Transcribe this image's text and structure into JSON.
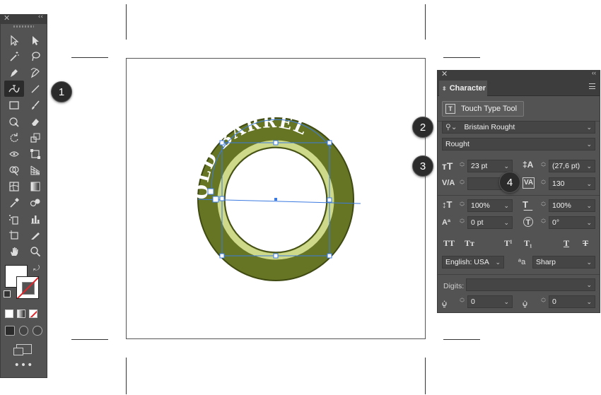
{
  "badges": [
    "1",
    "2",
    "3",
    "4"
  ],
  "artwork": {
    "curved_text": "OLD BARREL",
    "ring_color": "#667523",
    "ring_highlight": "#cfd98a",
    "text_color": "#ffffff",
    "selection_color": "#3b7ae0"
  },
  "character_panel": {
    "tab_label": "Character",
    "touch_type_label": "Touch Type Tool",
    "font_family": "Bristain Rought",
    "font_style": "Rought",
    "font_size": "23 pt",
    "leading": "(27,6 pt)",
    "kerning": "",
    "tracking": "130",
    "vertical_scale": "100%",
    "horizontal_scale": "100%",
    "baseline_shift": "0 pt",
    "rotation": "0°",
    "language": "English: USA",
    "antialias_icon": "ªa",
    "antialias": "Sharp",
    "digits_label": "Digits:",
    "digits_value": "",
    "arabic_left_value": "0",
    "arabic_right_value": "0"
  },
  "icons": {
    "close": "✕",
    "collapse": "‹‹",
    "more": "•••"
  }
}
